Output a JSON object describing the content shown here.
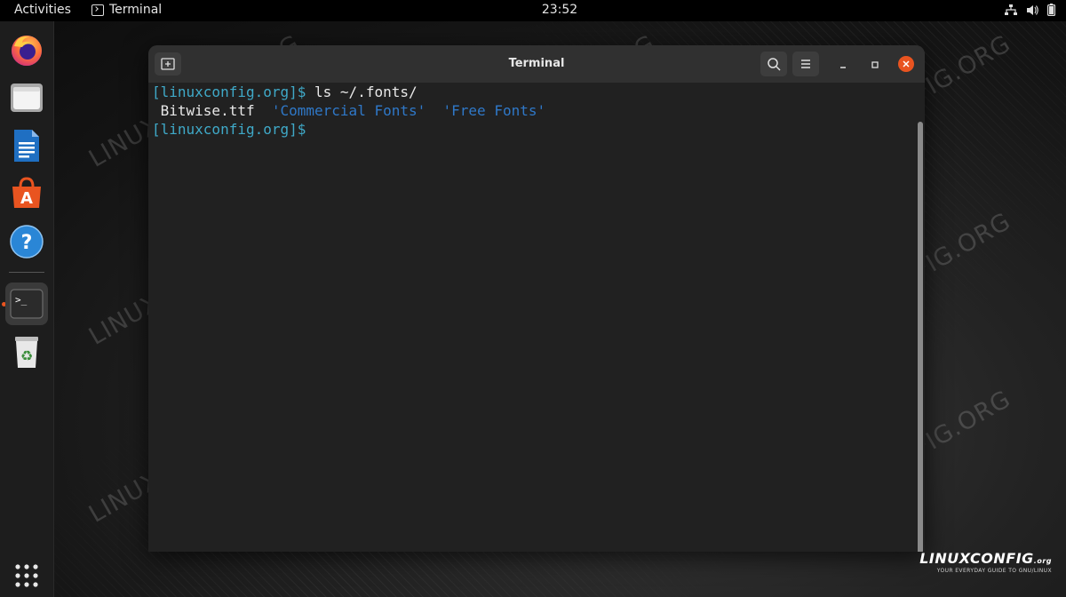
{
  "topbar": {
    "activities": "Activities",
    "app_name": "Terminal",
    "clock": "23:52",
    "tray_icons": [
      "network-icon",
      "volume-icon",
      "battery-icon"
    ]
  },
  "dock": {
    "items": [
      {
        "name": "firefox",
        "icon": "firefox-icon"
      },
      {
        "name": "files",
        "icon": "files-icon"
      },
      {
        "name": "writer",
        "icon": "writer-icon"
      },
      {
        "name": "software",
        "icon": "software-store-icon"
      },
      {
        "name": "help",
        "icon": "help-icon"
      },
      {
        "name": "terminal",
        "icon": "terminal-icon",
        "active": true
      },
      {
        "name": "trash",
        "icon": "trash-icon"
      }
    ],
    "show_apps_icon": "app-grid-icon"
  },
  "window": {
    "title": "Terminal",
    "lines": [
      {
        "prompt": "[linuxconfig.org]$",
        "command": " ls ~/.fonts/"
      },
      {
        "files": [
          {
            "text": " Bitwise.ttf",
            "kind": "file"
          },
          {
            "text": "  'Commercial Fonts'",
            "kind": "dir"
          },
          {
            "text": "  'Free Fonts'",
            "kind": "dir"
          }
        ]
      },
      {
        "prompt": "[linuxconfig.org]$",
        "command": ""
      }
    ]
  },
  "watermark": {
    "text": "LINUXCONFIG.ORG",
    "brand": "LINUXCONFIG",
    "brand_suffix": ".org",
    "tagline": "YOUR EVERYDAY GUIDE TO GNU/LINUX"
  },
  "colors": {
    "prompt": "#3fa9c8",
    "directory": "#2f78c8",
    "accent": "#e95420"
  }
}
